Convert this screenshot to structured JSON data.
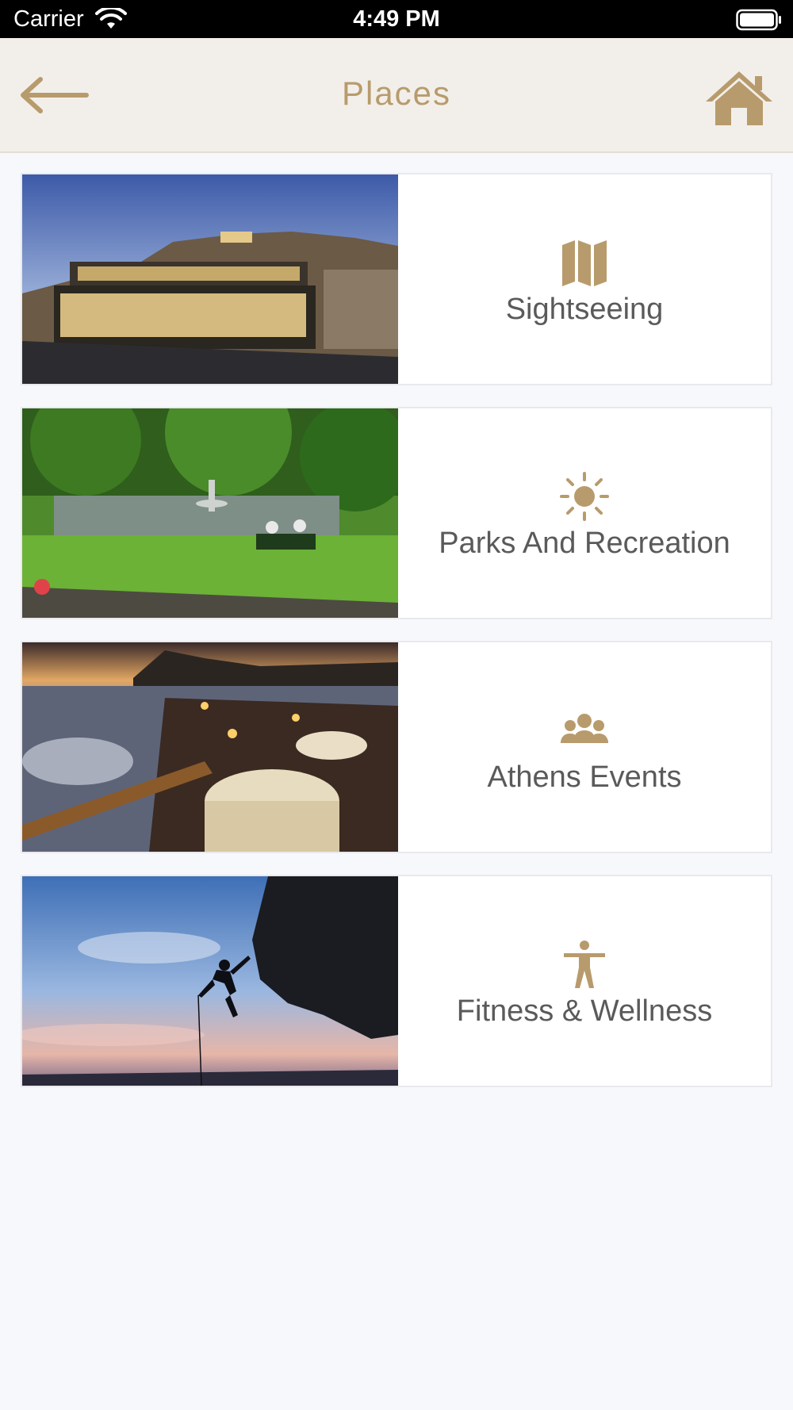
{
  "status_bar": {
    "carrier": "Carrier",
    "time": "4:49 PM",
    "wifi_icon": "wifi-icon",
    "battery_icon": "battery-icon"
  },
  "nav": {
    "title": "Places",
    "back_icon": "arrow-left-icon",
    "home_icon": "home-icon"
  },
  "accent_color": "#b89b6c",
  "cards": [
    {
      "label": "Sightseeing",
      "icon": "map-icon",
      "image": "illuminated museum below the Acropolis at dusk"
    },
    {
      "label": "Parks And Recreation",
      "icon": "sun-icon",
      "image": "park with pond, fountain and people on a bench"
    },
    {
      "label": "Athens Events",
      "icon": "people-icon",
      "image": "candle-lit dinner tables by the sea at sunset"
    },
    {
      "label": "Fitness & Wellness",
      "icon": "person-stretch-icon",
      "image": "silhouette of a climber on a cliff at sunset"
    }
  ]
}
